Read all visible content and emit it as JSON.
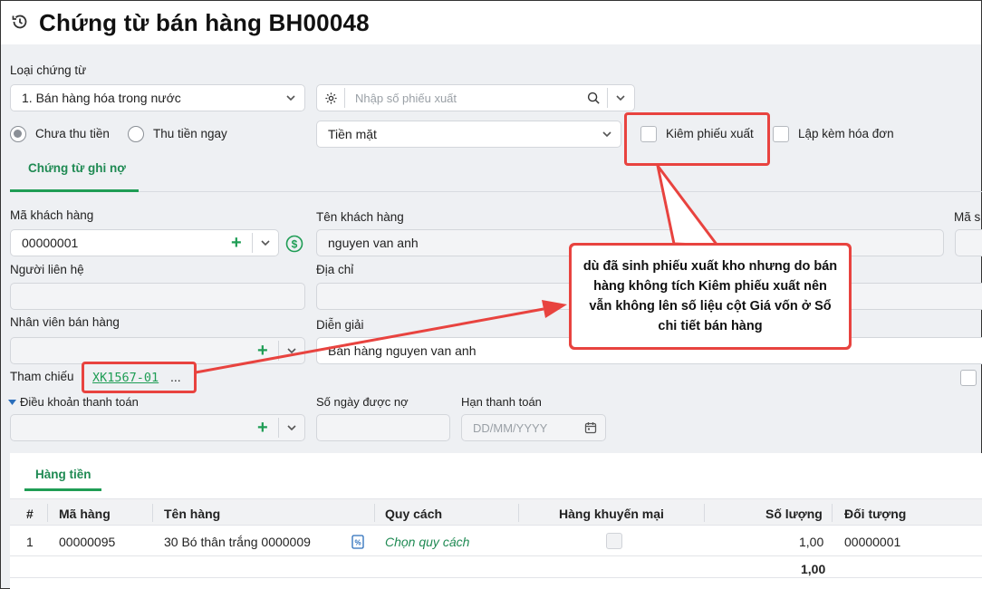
{
  "header": {
    "title": "Chứng từ bán hàng BH00048"
  },
  "form": {
    "voucher_type_label": "Loại chứng từ",
    "voucher_type_value": "1. Bán hàng hóa trong nước",
    "issue_slip_placeholder": "Nhập số phiếu xuất",
    "payment_unpaid_label": "Chưa thu tiền",
    "payment_paid_label": "Thu tiền ngay",
    "payment_method_value": "Tiền mặt",
    "issue_slip_checkbox_label": "Kiêm phiếu xuất",
    "invoice_checkbox_label": "Lập kèm hóa đơn",
    "tab_label": "Chứng từ ghi nợ",
    "customer_code_label": "Mã khách hàng",
    "customer_code_value": "00000001",
    "customer_name_label": "Tên khách hàng",
    "customer_name_value": "nguyen van anh",
    "tax_code_label_partial": "Mã s",
    "contact_label": "Người liên hệ",
    "address_label": "Địa chỉ",
    "salesperson_label": "Nhân viên bán hàng",
    "description_label": "Diễn giải",
    "description_value": "Bán hàng nguyen van anh",
    "reference_label": "Tham chiếu",
    "reference_value": "XK1567-01",
    "reference_more": "...",
    "payment_terms_label": "Điều khoản thanh toán",
    "credit_days_label": "Số ngày được nợ",
    "due_date_label": "Hạn thanh toán",
    "due_date_placeholder": "DD/MM/YYYY"
  },
  "callout": {
    "text": "dù đã sinh phiếu xuất kho nhưng do bán hàng không tích Kiêm phiếu xuất nên vẫn không lên số liệu cột Giá vốn ở Sổ chi tiết bán hàng"
  },
  "grid": {
    "tab_label": "Hàng tiền",
    "columns": [
      "#",
      "Mã hàng",
      "Tên hàng",
      "Quy cách",
      "Hàng khuyến mại",
      "Số lượng",
      "Đối tượng"
    ],
    "rows": [
      {
        "index": "1",
        "code": "00000095",
        "name": "30 Bó thân trắng 0000009",
        "spec": "Chọn quy cách",
        "quantity": "1,00",
        "object": "00000001"
      }
    ],
    "total_quantity": "1,00"
  },
  "colors": {
    "accent": "#1f9d55",
    "annotation": "#e8433f"
  }
}
